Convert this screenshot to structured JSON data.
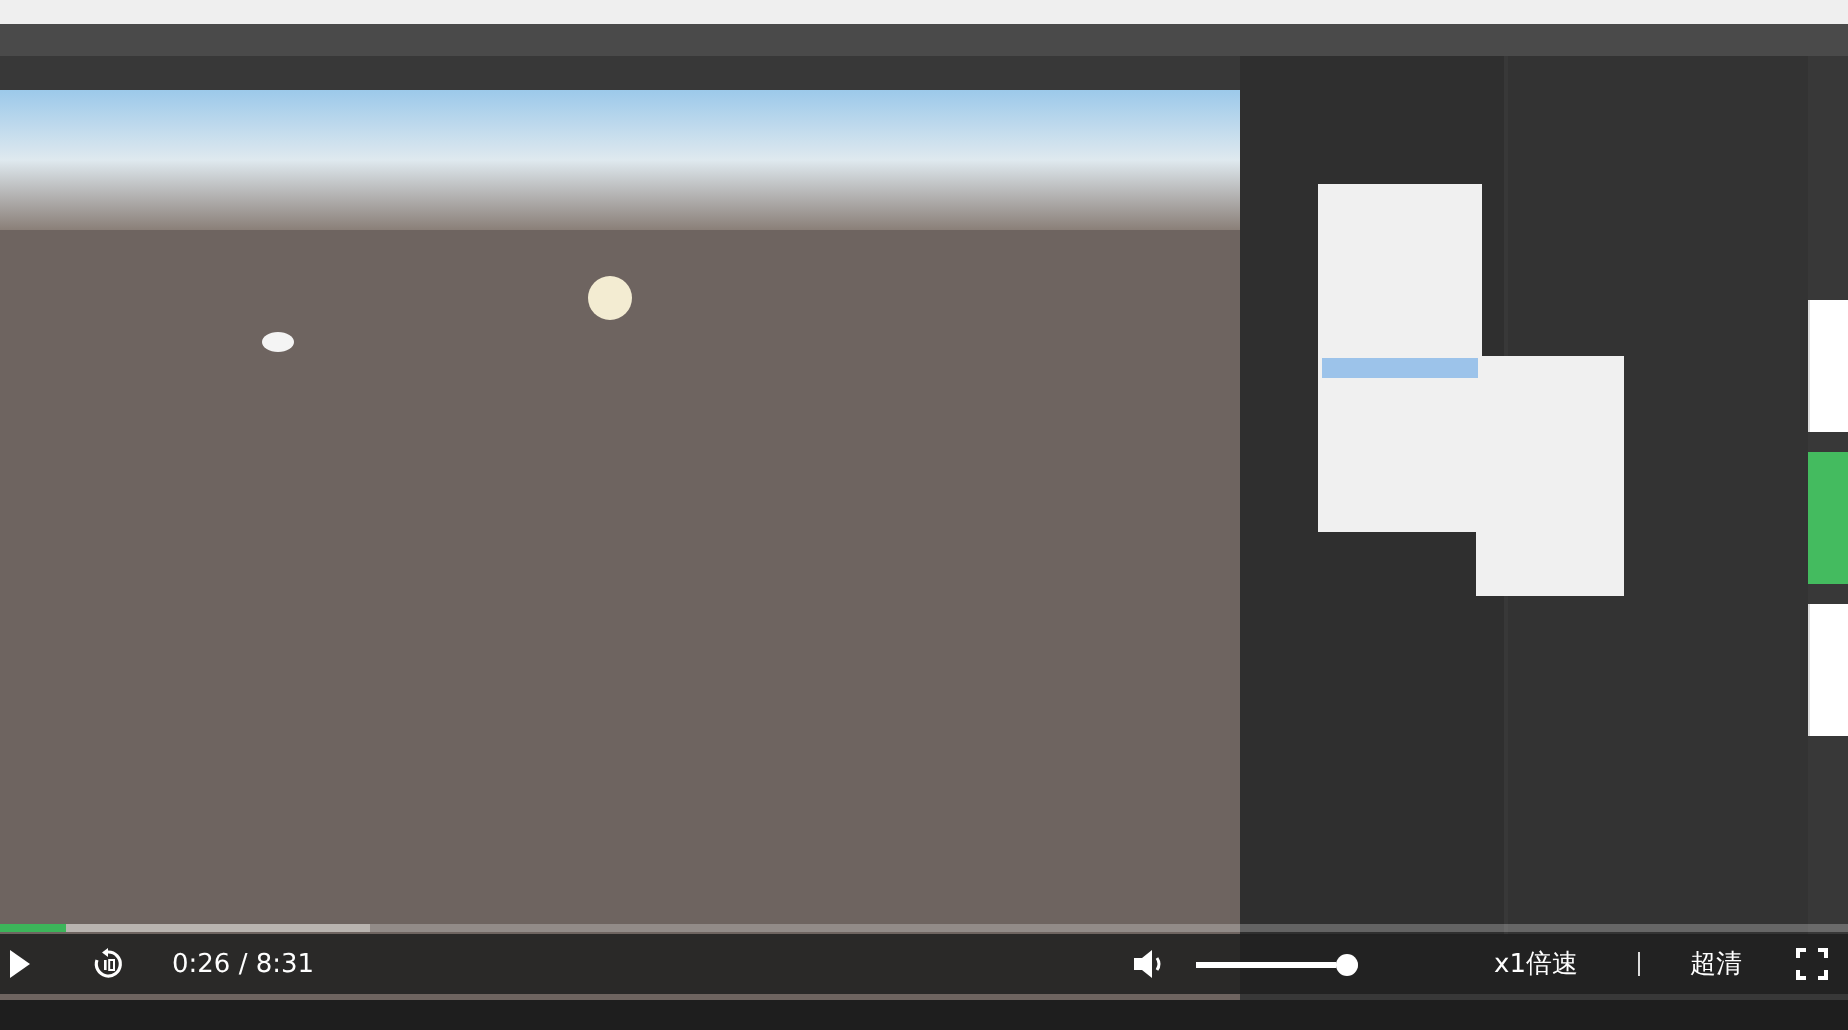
{
  "side_tabs": [
    {
      "selected": false
    },
    {
      "selected": true
    },
    {
      "selected": false
    }
  ],
  "player": {
    "progress": {
      "level": 0.036
    },
    "buffered": {
      "level": 0.2
    },
    "time": "0:26 / 8:31",
    "playing": false,
    "volume": {
      "level": 1
    },
    "speed": "x1倍速",
    "quality": "超清"
  }
}
